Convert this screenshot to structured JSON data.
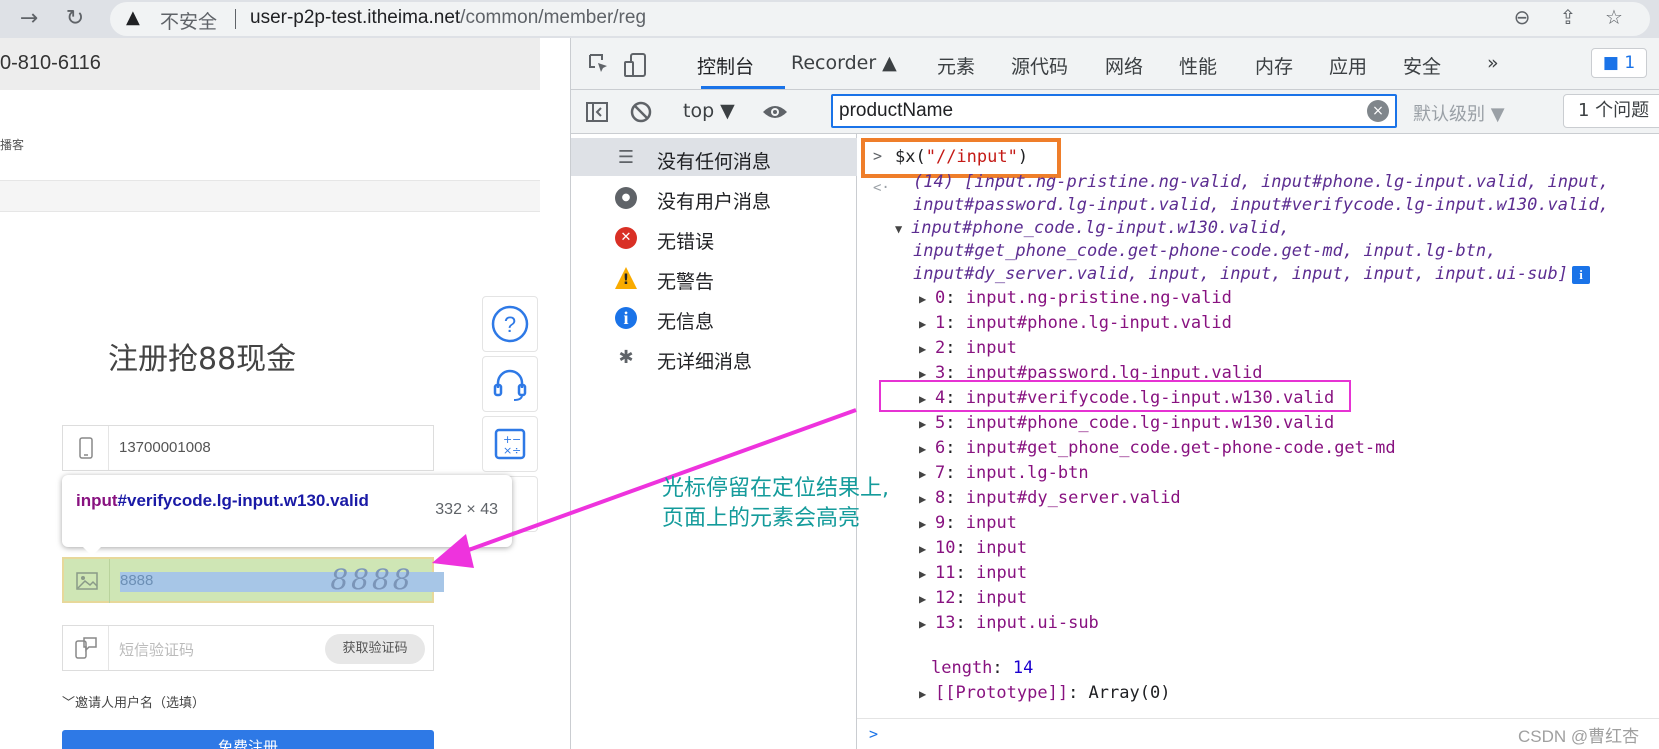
{
  "browser": {
    "back_icon": "back-arrow-icon",
    "forward_symbol": "→",
    "reload_symbol": "↻",
    "warning_symbol": "▲",
    "insecure_label": "不安全",
    "url_host": "user-p2p-test.itheima.net",
    "url_path": "/common/member/reg",
    "zoom_symbol": "⊖",
    "share_symbol": "⇪",
    "bookmark_symbol": "☆"
  },
  "page": {
    "phone": "0-810-6116",
    "nav_fragment": "播客",
    "title": "注册抢88现金",
    "fields": {
      "phone_value": "13700001008",
      "verify_value": "8888",
      "captcha_text": "8888",
      "sms_placeholder": "短信验证码",
      "sms_button": "获取验证码"
    },
    "invite": "﹀邀请人用户名（选填）",
    "register_button": "免费注册",
    "float_buttons": {
      "help": "?",
      "service": "☊",
      "calc": "±"
    }
  },
  "inspector_tooltip": {
    "tag": "input",
    "rest": "#verifycode.lg-input.w130.valid",
    "size": "332 × 43"
  },
  "devtools": {
    "tabs": [
      "控制台",
      "Recorder ▲",
      "元素",
      "源代码",
      "网络",
      "性能",
      "内存",
      "应用",
      "安全"
    ],
    "more_symbol": "»",
    "issues_badge": "1",
    "toolbar": {
      "context": "top ▼",
      "filter_value": "productName",
      "clear_symbol": "×",
      "levels": "默认级别 ▼",
      "issues_count": "1 个问题"
    },
    "sidebar": [
      {
        "icon": "list-icon",
        "glyph": "☰",
        "label": "没有任何消息",
        "color": "#5f6368"
      },
      {
        "icon": "user-icon",
        "glyph": "●",
        "label": "没有用户消息",
        "color": "#5f6368"
      },
      {
        "icon": "error-icon",
        "glyph": "✕",
        "label": "无错误",
        "color": "#d93025"
      },
      {
        "icon": "warning-icon",
        "glyph": "!",
        "label": "无警告",
        "color": "#f9ab00"
      },
      {
        "icon": "info-icon",
        "glyph": "i",
        "label": "无信息",
        "color": "#1a73e8"
      },
      {
        "icon": "bug-icon",
        "glyph": "✱",
        "label": "无详细消息",
        "color": "#5f6368"
      }
    ],
    "console": {
      "prompt": ">",
      "command_prefix": "$x(",
      "command_string": "\"//input\"",
      "command_suffix": ")",
      "summary_lines": [
        "(14) [input.ng-pristine.ng-valid, input#phone.lg-input.valid, input,",
        "input#password.lg-input.valid, input#verifycode.lg-input.w130.valid,",
        "input#phone_code.lg-input.w130.valid,",
        "input#get_phone_code.get-phone-code.get-md, input.lg-btn,",
        "input#dy_server.valid, input, input, input, input, input.ui-sub]"
      ],
      "info_badge": "i",
      "items": [
        {
          "idx": "0",
          "desc": "input.ng-pristine.ng-valid"
        },
        {
          "idx": "1",
          "desc": "input#phone.lg-input.valid"
        },
        {
          "idx": "2",
          "desc": "input"
        },
        {
          "idx": "3",
          "desc": "input#password.lg-input.valid"
        },
        {
          "idx": "4",
          "desc": "input#verifycode.lg-input.w130.valid"
        },
        {
          "idx": "5",
          "desc": "input#phone_code.lg-input.w130.valid"
        },
        {
          "idx": "6",
          "desc": "input#get_phone_code.get-phone-code.get-md"
        },
        {
          "idx": "7",
          "desc": "input.lg-btn"
        },
        {
          "idx": "8",
          "desc": "input#dy_server.valid"
        },
        {
          "idx": "9",
          "desc": "input"
        },
        {
          "idx": "10",
          "desc": "input"
        },
        {
          "idx": "11",
          "desc": "input"
        },
        {
          "idx": "12",
          "desc": "input"
        },
        {
          "idx": "13",
          "desc": "input.ui-sub"
        }
      ],
      "length_key": "length",
      "length_value": "14",
      "prototype_key": "[[Prototype]]",
      "prototype_value": "Array(0)"
    }
  },
  "annotation": {
    "line1": "光标停留在定位结果上,",
    "line2": "页面上的元素会高亮"
  },
  "watermark": "CSDN @曹红杏"
}
